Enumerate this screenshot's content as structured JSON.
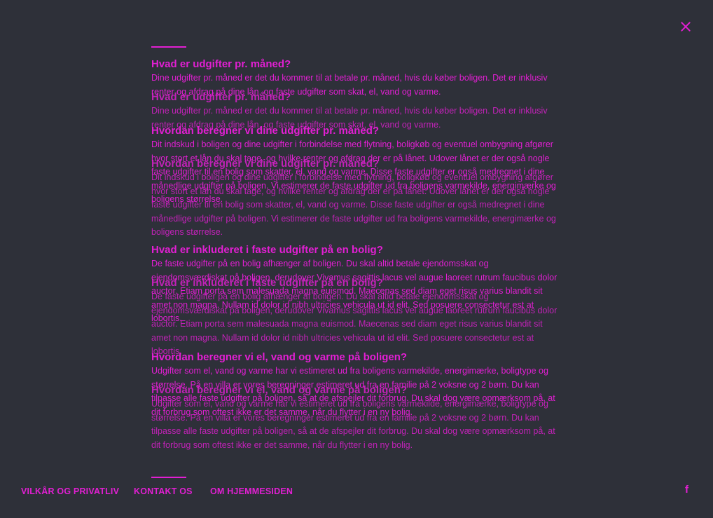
{
  "close_label": "Luk",
  "faq": [
    {
      "question": "Hvad er udgifter pr. måned?",
      "answer": "Dine udgifter pr. måned er det du kommer til at betale pr. måned, hvis du køber boligen. Det er inklusiv renter og afdrag på dine lån, og faste udgifter som skat, el, vand og varme."
    },
    {
      "question": "Hvordan beregner vi dine udgifter pr. måned?",
      "answer": "Dit indskud i boligen og dine udgifter i forbindelse med flytning, boligkøb og eventuel ombygning afgører hvor stort et lån du skal tage, og hvilke renter og afdrag der er på lånet. Udover lånet er der også nogle faste udgifter til en bolig som skatter, el, vand og varme. Disse faste udgifter er også medregnet i dine månedlige udgifter på boligen. Vi estimerer de faste udgifter ud fra boligens varmekilde, energimærke og boligens størrelse."
    },
    {
      "question": "Hvad er inkluderet i faste udgifter på en bolig?",
      "answer": "De faste udgifter på en bolig afhænger af boligen. Du skal altid betale ejendomsskat og ejendomsværdiskat på boligen, derudover Vivamus sagittis lacus vel augue laoreet rutrum faucibus dolor auctor. Etiam porta sem malesuada magna euismod. Maecenas sed diam eget risus varius blandit sit amet non magna. Nullam id dolor id nibh ultricies vehicula ut id elit. Sed posuere consectetur est at lobortis."
    },
    {
      "question": "Hvordan beregner vi el, vand og varme på boligen?",
      "answer": "Udgifter som el, vand og varme har vi estimeret ud fra boligens varmekilde, energimærke, boligtype og størrelse. På en villa er vores beregninger estimeret ud fra en familie på 2 voksne og 2 børn. Du kan tilpasse alle faste udgifter på boligen, så at de afspejler dit forbrug. Du skal dog være opmærksom på, at dit forbrug som oftest ikke er det samme, når du flytter i en ny bolig."
    }
  ],
  "footer": {
    "links": [
      "VILKÅR OG PRIVATLIV",
      "KONTAKT OS",
      "OM HJEMMESIDEN"
    ],
    "facebook_icon": "facebook-icon",
    "facebook_glyph": "f"
  },
  "colors": {
    "background": "#2e3039",
    "accent": "#e21fd3"
  }
}
